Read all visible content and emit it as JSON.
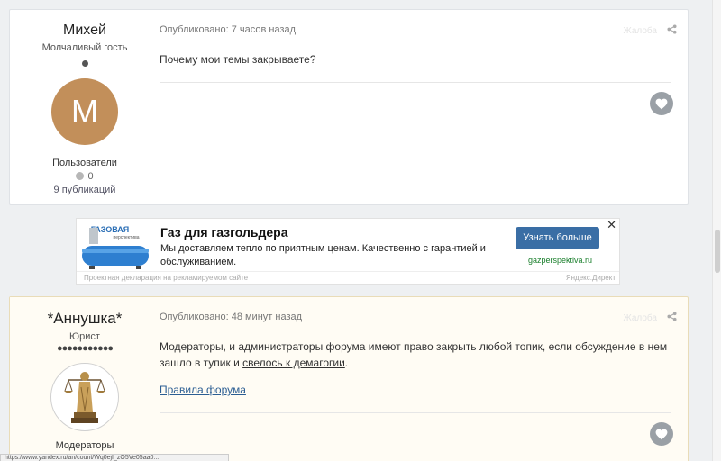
{
  "posts": [
    {
      "author": "Михей",
      "rank": "Молчаливый гость",
      "avatar_letter": "М",
      "avatar_color": "#c28f5a",
      "group": "Пользователи",
      "reputation": "0",
      "post_count": "9 публикаций",
      "published": "Опубликовано: 7 часов назад",
      "report": "Жалоба",
      "content": "Почему мои темы закрываете?"
    },
    {
      "author": "*Аннушка*",
      "rank": "Юрист",
      "rank_pips": "●●●●●●●●●●●",
      "group": "Модераторы",
      "published": "Опубликовано: 48 минут назад",
      "report": "Жалоба",
      "content_line1": "Модераторы, и администраторы форума имеют право закрыть любой топик, если обсуждение в нем",
      "content_line2_pre": "зашло в тупик и ",
      "content_line2_u": "свелось к демагогии",
      "content_line2_post": ".",
      "link": "Правила форума"
    }
  ],
  "ad": {
    "logo_text": "ГАЗОВАЯ",
    "logo_sub": "перспектива",
    "title": "Газ для газгольдера",
    "text": "Мы доставляем тепло по приятным ценам. Качественно с гарантией и обслуживанием.",
    "button": "Узнать больше",
    "domain": "gazperspektiva.ru",
    "close": "✕",
    "footer_left": "Проектная декларация на рекламируемом сайте",
    "footer_right": "Яндекс.Директ"
  },
  "statusbar": "https://www.yandex.ru/an/count/Wq0ejI_zO5Ve05aa0...",
  "colors": {
    "accent": "#3a6ea5",
    "link": "#2c5e93",
    "highlight_bg": "#fffcf4"
  }
}
